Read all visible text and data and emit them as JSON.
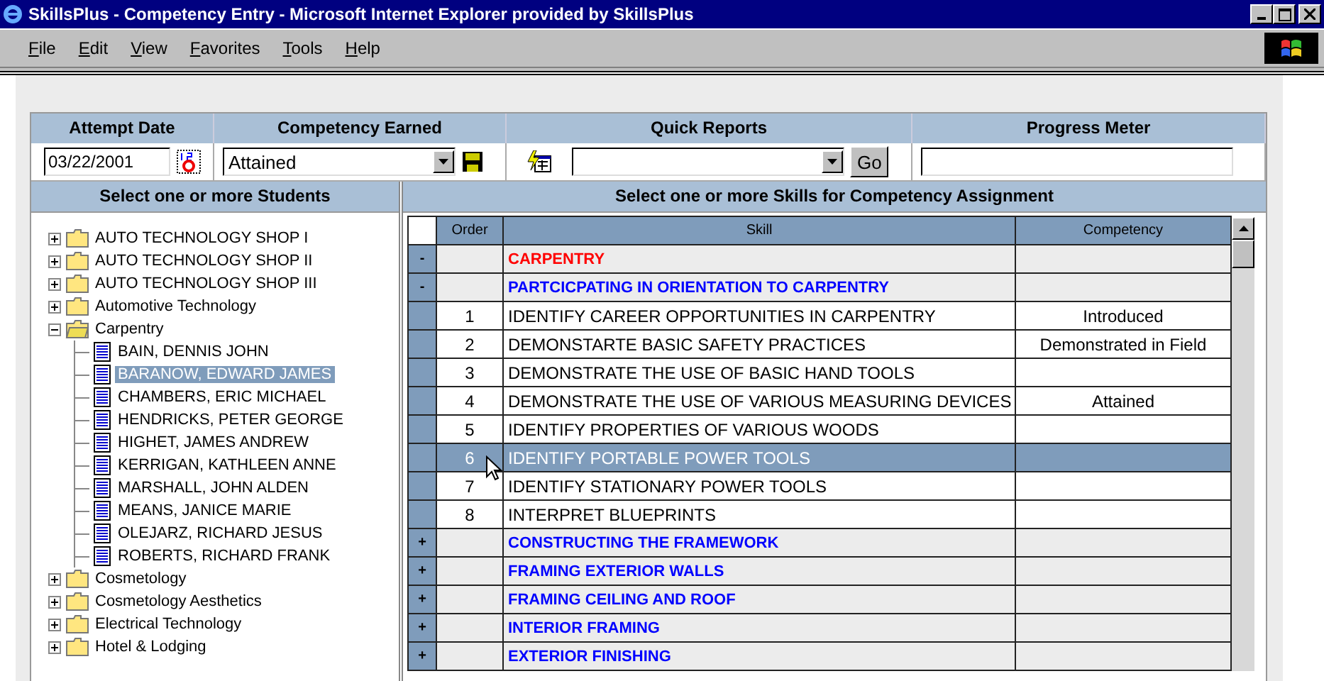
{
  "window": {
    "title": "SkillsPlus - Competency Entry - Microsoft Internet Explorer provided by SkillsPlus"
  },
  "menu": [
    "File",
    "Edit",
    "View",
    "Favorites",
    "Tools",
    "Help"
  ],
  "form": {
    "columns": [
      "Attempt Date",
      "Competency Earned",
      "Quick Reports",
      "Progress Meter"
    ],
    "attempt_date": {
      "value": "03/22/2001"
    },
    "competency_earned": {
      "value": "Attained"
    },
    "quick_reports": {
      "button": "Go"
    }
  },
  "students": {
    "title": "Select one or more Students",
    "tree": [
      {
        "label": "AUTO TECHNOLOGY SHOP I",
        "expanded": false
      },
      {
        "label": "AUTO TECHNOLOGY SHOP II",
        "expanded": false
      },
      {
        "label": "AUTO TECHNOLOGY SHOP III",
        "expanded": false
      },
      {
        "label": "Automotive Technology",
        "expanded": false
      },
      {
        "label": "Carpentry",
        "expanded": true,
        "children": [
          {
            "label": "BAIN, DENNIS JOHN",
            "selected": false
          },
          {
            "label": "BARANOW, EDWARD JAMES",
            "selected": true
          },
          {
            "label": "CHAMBERS, ERIC MICHAEL",
            "selected": false
          },
          {
            "label": "HENDRICKS, PETER GEORGE",
            "selected": false
          },
          {
            "label": "HIGHET, JAMES ANDREW",
            "selected": false
          },
          {
            "label": "KERRIGAN, KATHLEEN ANNE",
            "selected": false
          },
          {
            "label": "MARSHALL, JOHN ALDEN",
            "selected": false
          },
          {
            "label": "MEANS, JANICE MARIE",
            "selected": false
          },
          {
            "label": "OLEJARZ, RICHARD JESUS",
            "selected": false
          },
          {
            "label": "ROBERTS, RICHARD FRANK",
            "selected": false
          }
        ]
      },
      {
        "label": "Cosmetology",
        "expanded": false
      },
      {
        "label": "Cosmetology Aesthetics",
        "expanded": false
      },
      {
        "label": "Electrical Technology",
        "expanded": false
      },
      {
        "label": "Hotel & Lodging",
        "expanded": false
      }
    ]
  },
  "skills": {
    "title": "Select one or more Skills for Competency Assignment",
    "columns": [
      "Order",
      "Skill",
      "Competency"
    ],
    "rows": [
      {
        "kind": "category",
        "toggle": "-",
        "skill": "CARPENTRY",
        "selected": false
      },
      {
        "kind": "group",
        "toggle": "-",
        "skill": "PARTCICPATING IN ORIENTATION TO CARPENTRY",
        "selected": false
      },
      {
        "kind": "skill",
        "order": "1",
        "skill": "IDENTIFY CAREER OPPORTUNITIES IN CARPENTRY",
        "competency": "Introduced",
        "selected": false
      },
      {
        "kind": "skill",
        "order": "2",
        "skill": "DEMONSTARTE BASIC SAFETY PRACTICES",
        "competency": "Demonstrated in Field",
        "selected": false
      },
      {
        "kind": "skill",
        "order": "3",
        "skill": "DEMONSTRATE THE USE OF BASIC HAND TOOLS",
        "selected": false
      },
      {
        "kind": "skill",
        "order": "4",
        "skill": "DEMONSTRATE THE USE OF VARIOUS MEASURING DEVICES",
        "competency": "Attained",
        "selected": false
      },
      {
        "kind": "skill",
        "order": "5",
        "skill": "IDENTIFY PROPERTIES OF VARIOUS WOODS",
        "selected": false
      },
      {
        "kind": "skill",
        "order": "6",
        "skill": "IDENTIFY PORTABLE POWER TOOLS",
        "selected": true
      },
      {
        "kind": "skill",
        "order": "7",
        "skill": "IDENTIFY STATIONARY POWER TOOLS",
        "selected": false
      },
      {
        "kind": "skill",
        "order": "8",
        "skill": "INTERPRET BLUEPRINTS",
        "selected": false
      },
      {
        "kind": "group",
        "toggle": "+",
        "skill": "CONSTRUCTING THE FRAMEWORK",
        "selected": false
      },
      {
        "kind": "group",
        "toggle": "+",
        "skill": "FRAMING EXTERIOR WALLS",
        "selected": false
      },
      {
        "kind": "group",
        "toggle": "+",
        "skill": "FRAMING CEILING AND ROOF",
        "selected": false
      },
      {
        "kind": "group",
        "toggle": "+",
        "skill": "INTERIOR FRAMING",
        "selected": false
      },
      {
        "kind": "group",
        "toggle": "+",
        "skill": "EXTERIOR FINISHING",
        "selected": false
      }
    ]
  }
}
